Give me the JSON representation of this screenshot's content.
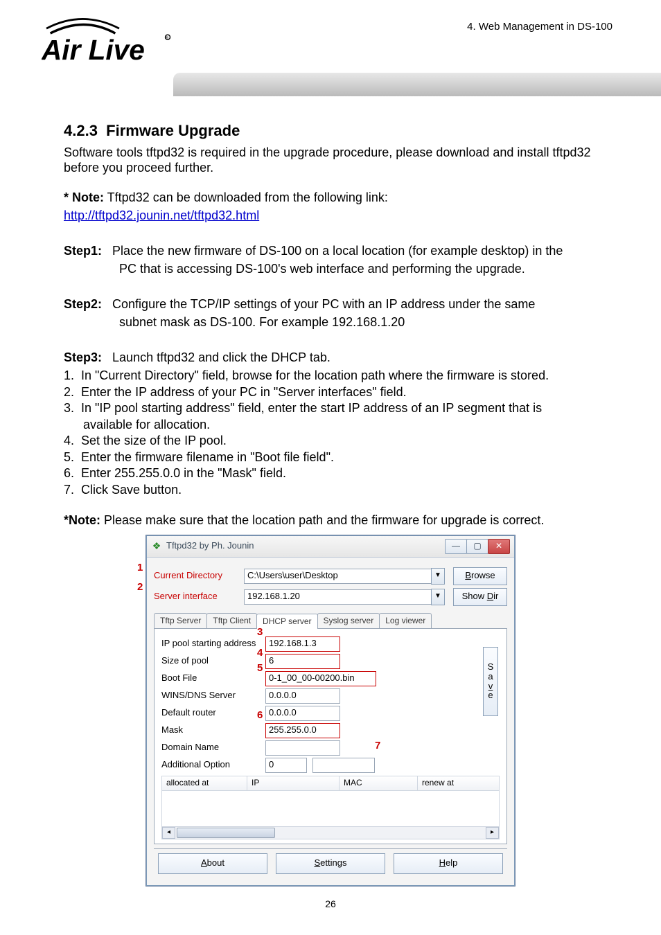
{
  "chapter_ref": "4. Web Management in DS-100",
  "logo_alt": "Air Live",
  "section_number": "4.2.3",
  "section_title": "Firmware Upgrade",
  "intro_para": "Software tools tftpd32 is required in the upgrade procedure, please download and install tftpd32 before you proceed further.",
  "note_label": "* Note:",
  "note_text": " Tftpd32 can be downloaded from the following link:",
  "note_link": "http://tftpd32.jounin.net/tftpd32.html",
  "step1_label": "Step1:",
  "step1_line1": "Place the new firmware of DS-100 on a local location (for example desktop) in the",
  "step1_line2": "PC that is accessing DS-100's web interface and performing the upgrade.",
  "step2_label": "Step2:",
  "step2_line1": "Configure the TCP/IP settings of your PC with an IP address under the same",
  "step2_line2": "subnet mask as DS-100. For example 192.168.1.20",
  "step3_label": "Step3:",
  "step3_line1": "Launch tftpd32 and click the DHCP tab.",
  "bullets": {
    "b1": "In \"Current Directory\" field, browse for the location path where the firmware is stored.",
    "b2": "Enter the IP address of your PC in \"Server interfaces\" field.",
    "b3a": "In \"IP pool starting address\" field, enter the start IP address of an IP segment that is",
    "b3b": "available for allocation.",
    "b4": "Set the size of the IP pool.",
    "b5": "Enter the firmware filename in \"Boot file field\".",
    "b6": "Enter 255.255.0.0 in the \"Mask\" field.",
    "b7": "Click Save button."
  },
  "note2_label": "*Note:",
  "note2_text": " Please make sure that the location path and the firmware for upgrade is correct.",
  "tftpd": {
    "title": "Tftpd32 by Ph. Jounin",
    "cur_dir_label": "Current Directory",
    "cur_dir_value": "C:\\Users\\user\\Desktop",
    "browse_btn": "Browse",
    "srv_if_label": "Server interface",
    "srv_if_value": "192.168.1.20",
    "show_dir_btn": "Show Dir",
    "tabs": {
      "t1": "Tftp Server",
      "t2": "Tftp Client",
      "t3": "DHCP server",
      "t4": "Syslog server",
      "t5": "Log viewer"
    },
    "fields": {
      "ip_pool_label": "IP pool starting address",
      "ip_pool_value": "192.168.1.3",
      "size_label": "Size of pool",
      "size_value": "6",
      "boot_label": "Boot File",
      "boot_value": "0-1_00_00-00200.bin",
      "wins_label": "WINS/DNS Server",
      "wins_value": "0.0.0.0",
      "router_label": "Default router",
      "router_value": "0.0.0.0",
      "mask_label": "Mask",
      "mask_value": "255.255.0.0",
      "domain_label": "Domain Name",
      "domain_value": "",
      "addopt_label": "Additional Option",
      "addopt_value": "0"
    },
    "save_vertical": "Save",
    "list_headers": {
      "h1": "allocated at",
      "h2": "IP",
      "h3": "MAC",
      "h4": "renew at"
    },
    "bottom": {
      "about": "About",
      "settings": "Settings",
      "help": "Help"
    }
  },
  "annotations": {
    "a1": "1",
    "a2": "2",
    "a3": "3",
    "a4": "4",
    "a5": "5",
    "a6": "6",
    "a7": "7"
  },
  "page_number": "26"
}
